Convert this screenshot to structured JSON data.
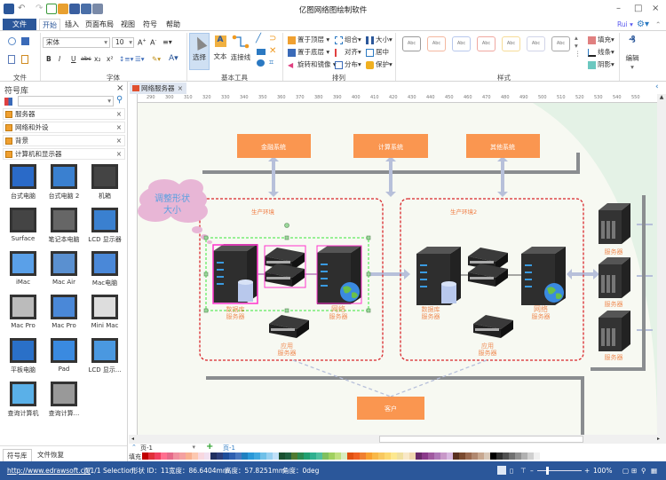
{
  "app": {
    "title": "亿图网络图绘制软件",
    "user": "Rui"
  },
  "menu_tabs": [
    "文件",
    "开始",
    "插入",
    "页面布局",
    "视图",
    "符号",
    "帮助"
  ],
  "ribbon": {
    "groups": {
      "file": "文件",
      "font": "字体",
      "basic_tools": "基本工具",
      "arrange": "排列",
      "style": "样式"
    },
    "font_name": "宋体",
    "font_size": "10",
    "format_buttons": [
      "B",
      "I",
      "U",
      "abc",
      "x₂",
      "x²"
    ],
    "tools": {
      "select": "选择",
      "text": "文本",
      "connector": "连接线"
    },
    "arrange": {
      "bring_front": "置于顶层",
      "send_back": "置于底层",
      "rotate": "旋转和镜像",
      "group": "组合",
      "align": "对齐",
      "distribute": "分布",
      "size": "大小",
      "center": "居中",
      "protect": "保护"
    },
    "style_sample": "Abc",
    "style_colors": [
      "#9a9a9a",
      "#f4b8a0",
      "#b8c8ec",
      "#f0a8a0",
      "#f6dc98",
      "#d0d4e8",
      "#a8a8a8"
    ],
    "fill": "填充",
    "line": "线条",
    "shadow": "阴影",
    "edit": "编辑"
  },
  "library": {
    "title": "符号库",
    "categories": [
      "服务器",
      "网络和外设",
      "背景",
      "计算机和显示器"
    ],
    "items": [
      "台式电脑",
      "台式电脑 2",
      "机箱",
      "Surface",
      "笔记本电脑",
      "LCD 显示器",
      "iMac",
      "Mac Air",
      "Mac电脑",
      "Mac Pro",
      "Mac Pro",
      "Mini Mac",
      "平板电脑",
      "Pad",
      "LCD 显示...",
      "查询计算机",
      "查询计算..."
    ],
    "bottom_tabs": [
      "符号库",
      "文件恢复"
    ]
  },
  "document": {
    "tab": "网络服务器",
    "ruler": [
      "290",
      "300",
      "310",
      "320",
      "330",
      "340",
      "350",
      "360",
      "370",
      "380",
      "390",
      "400",
      "410",
      "420",
      "430",
      "440",
      "450",
      "460",
      "470",
      "480",
      "490",
      "500",
      "510",
      "520",
      "530",
      "540",
      "550"
    ]
  },
  "diagram": {
    "systems": [
      "金融系统",
      "计算系统",
      "其他系统"
    ],
    "env1": "生产环境",
    "env2": "生产环境2",
    "callout": [
      "调整形状",
      "大小"
    ],
    "db_server": [
      "数据库",
      "服务器"
    ],
    "web_server": [
      "网络",
      "服务器"
    ],
    "app_server": [
      "应用",
      "服务器"
    ],
    "server": "服务器",
    "client": "客户",
    "colors": {
      "box": "#fa9650",
      "env_border": "#d9262a",
      "arrow": "#b7c0da",
      "bus": "#8a8d90",
      "selection": "#39e639",
      "highlight": "#ff33cc"
    }
  },
  "pages": {
    "current": "页-1",
    "tab": "页-1",
    "fill_label": "填充"
  },
  "palette": [
    "#c00000",
    "#e0303a",
    "#f04060",
    "#ff6f8f",
    "#e56a8a",
    "#f090a0",
    "#f4a0a0",
    "#f8b090",
    "#fcc8b0",
    "#f8d8e0",
    "#f0e0f0",
    "#203060",
    "#2c3e7a",
    "#1f4e9a",
    "#3060b0",
    "#4a78c0",
    "#2080c0",
    "#2a98d8",
    "#40a8e0",
    "#70c0e8",
    "#98d0f0",
    "#c0e0f8",
    "#1a5030",
    "#206040",
    "#507a30",
    "#2a8a50",
    "#20a070",
    "#30b090",
    "#50c0a0",
    "#80c060",
    "#a0d060",
    "#c0e080",
    "#d8ecc0",
    "#e05010",
    "#f06020",
    "#f08030",
    "#f8a030",
    "#f8b848",
    "#f8c860",
    "#fcd870",
    "#fce890",
    "#f0e0a0",
    "#f8e8c8",
    "#f0d8b0",
    "#6a2a6a",
    "#8a3a8a",
    "#a05aa0",
    "#b078b8",
    "#c898c8",
    "#d8b8e0",
    "#5a3020",
    "#7a4a30",
    "#9a6a50",
    "#b08870",
    "#c8a890",
    "#d8c8b8",
    "#000000",
    "#303030",
    "#505050",
    "#707070",
    "#909090",
    "#b0b0b0",
    "#d0d0d0",
    "#f0f0f0"
  ],
  "status": {
    "url": "http://www.edrawsoft.cn/",
    "page": "页1/1",
    "mode": "Selection",
    "shape_id": "形状 ID：11",
    "width": "宽度：86.6404mm",
    "height": "高度：57.8251mm",
    "angle": "角度：0deg",
    "zoom": "100%",
    "zoom_level": 100
  }
}
